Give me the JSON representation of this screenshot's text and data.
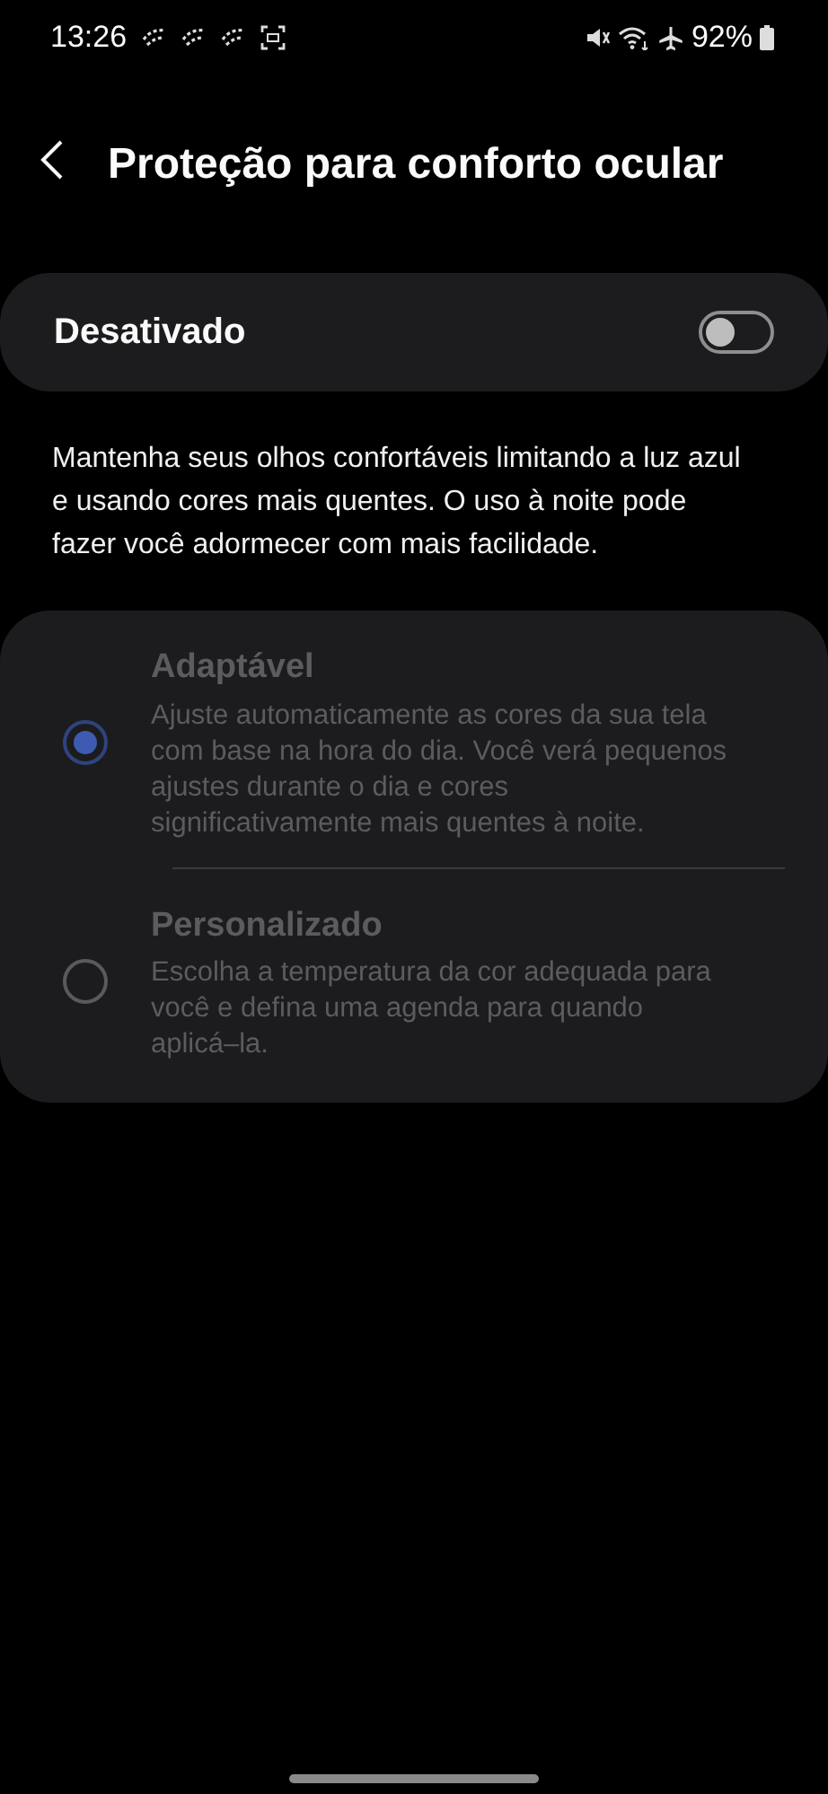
{
  "status_bar": {
    "time": "13:26",
    "battery": "92%"
  },
  "header": {
    "title": "Proteção para conforto ocular"
  },
  "master_switch": {
    "label": "Desativado",
    "on": false
  },
  "description": "Mantenha seus olhos confortáveis limitando a luz azul e usando cores mais quentes. O uso à noite pode fazer você adormecer com mais facilidade.",
  "options": [
    {
      "title": "Adaptável",
      "subtitle": "Ajuste automaticamente as cores da sua tela com base na hora do dia. Você verá pequenos ajustes durante o dia e cores significativamente mais quentes à noite.",
      "selected": true,
      "disabled": true
    },
    {
      "title": "Personalizado",
      "subtitle": "Escolha a temperatura da cor adequada para você e defina uma agenda para quando aplicá–la.",
      "selected": false,
      "disabled": true
    }
  ]
}
